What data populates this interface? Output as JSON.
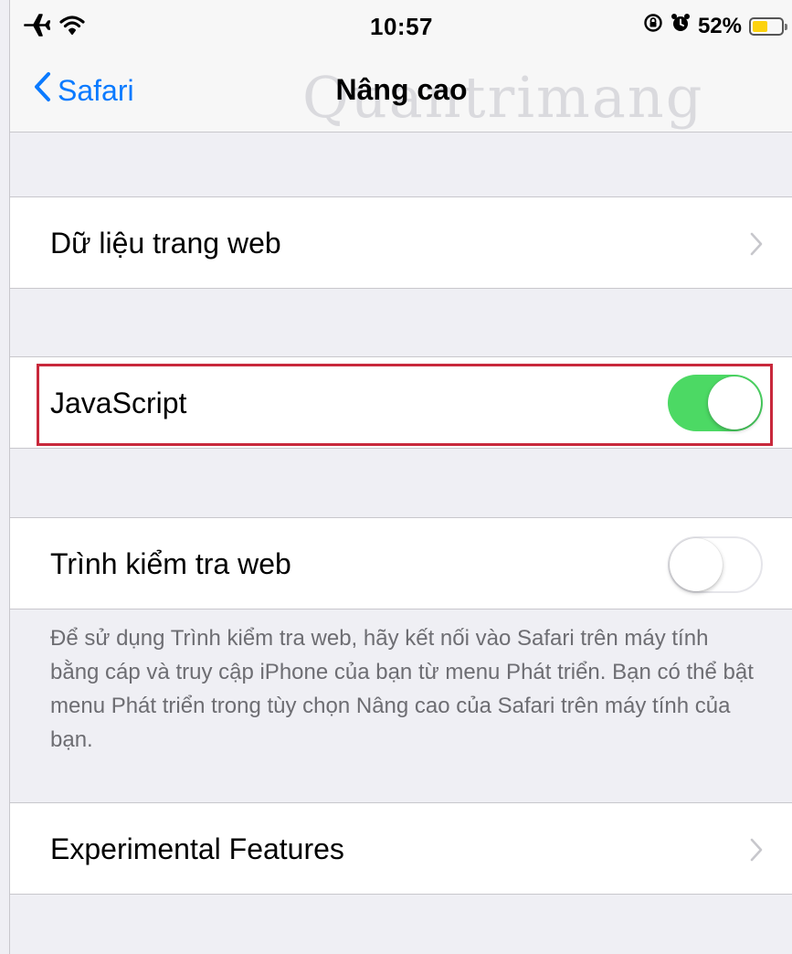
{
  "status_bar": {
    "time": "10:57",
    "battery_percent": "52%",
    "battery_level": 0.52,
    "icons": [
      "airplane-icon",
      "wifi-icon",
      "orientation-lock-icon",
      "alarm-icon",
      "battery-icon"
    ]
  },
  "nav": {
    "back_label": "Safari",
    "title": "Nâng cao",
    "watermark": "Quantrimang"
  },
  "rows": {
    "website_data": {
      "label": "Dữ liệu trang web"
    },
    "javascript": {
      "label": "JavaScript",
      "enabled": true
    },
    "web_inspector": {
      "label": "Trình kiểm tra web",
      "enabled": false,
      "footer": "Để sử dụng Trình kiểm tra web, hãy kết nối vào Safari trên máy tính bằng cáp và truy cập iPhone của bạn từ menu Phát triển. Bạn có thể bật menu Phát triển trong tùy chọn Nâng cao của Safari trên máy tính của bạn."
    },
    "experimental": {
      "label": "Experimental Features"
    }
  },
  "colors": {
    "accent": "#0a7aff",
    "toggle_on": "#4cd964",
    "highlight": "#c8283b",
    "background": "#efeff4"
  }
}
